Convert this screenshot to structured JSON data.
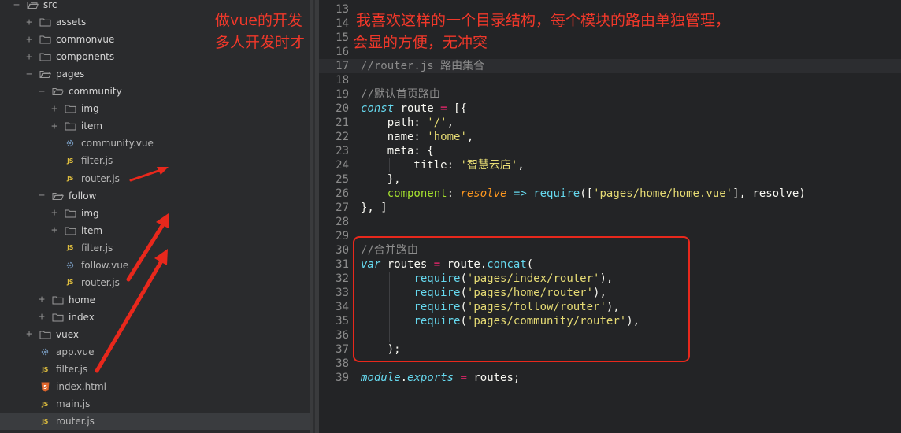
{
  "sidebar": {
    "items": [
      {
        "name": "src",
        "type": "folder",
        "open": true,
        "depth": 0
      },
      {
        "name": "assets",
        "type": "folder",
        "open": false,
        "depth": 1
      },
      {
        "name": "commonvue",
        "type": "folder",
        "open": false,
        "depth": 1
      },
      {
        "name": "components",
        "type": "folder",
        "open": false,
        "depth": 1
      },
      {
        "name": "pages",
        "type": "folder",
        "open": true,
        "depth": 1
      },
      {
        "name": "community",
        "type": "folder",
        "open": true,
        "depth": 2
      },
      {
        "name": "img",
        "type": "folder",
        "open": false,
        "depth": 3
      },
      {
        "name": "item",
        "type": "folder",
        "open": false,
        "depth": 3
      },
      {
        "name": "community.vue",
        "type": "vue",
        "depth": 3
      },
      {
        "name": "filter.js",
        "type": "js",
        "depth": 3
      },
      {
        "name": "router.js",
        "type": "js",
        "depth": 3
      },
      {
        "name": "follow",
        "type": "folder",
        "open": true,
        "depth": 2
      },
      {
        "name": "img",
        "type": "folder",
        "open": false,
        "depth": 3
      },
      {
        "name": "item",
        "type": "folder",
        "open": false,
        "depth": 3
      },
      {
        "name": "filter.js",
        "type": "js",
        "depth": 3
      },
      {
        "name": "follow.vue",
        "type": "vue",
        "depth": 3
      },
      {
        "name": "router.js",
        "type": "js",
        "depth": 3
      },
      {
        "name": "home",
        "type": "folder",
        "open": false,
        "depth": 2
      },
      {
        "name": "index",
        "type": "folder",
        "open": false,
        "depth": 2
      },
      {
        "name": "vuex",
        "type": "folder",
        "open": false,
        "depth": 1
      },
      {
        "name": "app.vue",
        "type": "vue",
        "depth": 1
      },
      {
        "name": "filter.js",
        "type": "js",
        "depth": 1
      },
      {
        "name": "index.html",
        "type": "html",
        "depth": 1
      },
      {
        "name": "main.js",
        "type": "js",
        "depth": 1
      },
      {
        "name": "router.js",
        "type": "js",
        "depth": 1,
        "selected": true
      }
    ]
  },
  "editor": {
    "lines": [
      {
        "n": "13",
        "tokens": []
      },
      {
        "n": "14",
        "tokens": []
      },
      {
        "n": "15",
        "tokens": []
      },
      {
        "n": "16",
        "tokens": []
      },
      {
        "n": "17",
        "active": true,
        "tokens": [
          {
            "t": "comment",
            "v": "//router.js 路由集合"
          }
        ]
      },
      {
        "n": "18",
        "tokens": []
      },
      {
        "n": "19",
        "tokens": [
          {
            "t": "comment",
            "v": "//默认首页路由"
          }
        ]
      },
      {
        "n": "20",
        "tokens": [
          {
            "t": "keyword",
            "v": "const"
          },
          {
            "t": "default",
            "v": " route "
          },
          {
            "t": "op",
            "v": "="
          },
          {
            "t": "default",
            "v": " [{"
          }
        ]
      },
      {
        "n": "21",
        "tokens": [
          {
            "t": "default",
            "v": "    path: "
          },
          {
            "t": "string",
            "v": "'/'"
          },
          {
            "t": "default",
            "v": ","
          }
        ]
      },
      {
        "n": "22",
        "tokens": [
          {
            "t": "default",
            "v": "    name: "
          },
          {
            "t": "string",
            "v": "'home'"
          },
          {
            "t": "default",
            "v": ","
          }
        ]
      },
      {
        "n": "23",
        "tokens": [
          {
            "t": "default",
            "v": "    meta: {"
          }
        ]
      },
      {
        "n": "24",
        "tokens": [
          {
            "t": "default",
            "v": "        title: "
          },
          {
            "t": "string",
            "v": "'智慧云店'"
          },
          {
            "t": "default",
            "v": ","
          }
        ]
      },
      {
        "n": "25",
        "tokens": [
          {
            "t": "default",
            "v": "    },"
          }
        ]
      },
      {
        "n": "26",
        "tokens": [
          {
            "t": "default",
            "v": "    "
          },
          {
            "t": "prop",
            "v": "component"
          },
          {
            "t": "default",
            "v": ": "
          },
          {
            "t": "param",
            "v": "resolve"
          },
          {
            "t": "default",
            "v": " "
          },
          {
            "t": "func",
            "v": "=>"
          },
          {
            "t": "default",
            "v": " "
          },
          {
            "t": "func",
            "v": "require"
          },
          {
            "t": "default",
            "v": "(["
          },
          {
            "t": "string",
            "v": "'pages/home/home.vue'"
          },
          {
            "t": "default",
            "v": "], resolve)"
          }
        ]
      },
      {
        "n": "27",
        "tokens": [
          {
            "t": "default",
            "v": "}, ]"
          }
        ]
      },
      {
        "n": "28",
        "tokens": []
      },
      {
        "n": "29",
        "tokens": []
      },
      {
        "n": "30",
        "tokens": [
          {
            "t": "comment",
            "v": "//合并路由"
          }
        ]
      },
      {
        "n": "31",
        "tokens": [
          {
            "t": "keyword",
            "v": "var"
          },
          {
            "t": "default",
            "v": " routes "
          },
          {
            "t": "op",
            "v": "="
          },
          {
            "t": "default",
            "v": " route."
          },
          {
            "t": "func",
            "v": "concat"
          },
          {
            "t": "default",
            "v": "("
          }
        ]
      },
      {
        "n": "32",
        "tokens": [
          {
            "t": "default",
            "v": "        "
          },
          {
            "t": "func",
            "v": "require"
          },
          {
            "t": "default",
            "v": "("
          },
          {
            "t": "string",
            "v": "'pages/index/router'"
          },
          {
            "t": "default",
            "v": "),"
          }
        ]
      },
      {
        "n": "33",
        "tokens": [
          {
            "t": "default",
            "v": "        "
          },
          {
            "t": "func",
            "v": "require"
          },
          {
            "t": "default",
            "v": "("
          },
          {
            "t": "string",
            "v": "'pages/home/router'"
          },
          {
            "t": "default",
            "v": "),"
          }
        ]
      },
      {
        "n": "34",
        "tokens": [
          {
            "t": "default",
            "v": "        "
          },
          {
            "t": "func",
            "v": "require"
          },
          {
            "t": "default",
            "v": "("
          },
          {
            "t": "string",
            "v": "'pages/follow/router'"
          },
          {
            "t": "default",
            "v": "),"
          }
        ]
      },
      {
        "n": "35",
        "tokens": [
          {
            "t": "default",
            "v": "        "
          },
          {
            "t": "func",
            "v": "require"
          },
          {
            "t": "default",
            "v": "("
          },
          {
            "t": "string",
            "v": "'pages/community/router'"
          },
          {
            "t": "default",
            "v": "),"
          }
        ]
      },
      {
        "n": "36",
        "tokens": []
      },
      {
        "n": "37",
        "tokens": [
          {
            "t": "default",
            "v": "    );"
          }
        ]
      },
      {
        "n": "38",
        "tokens": []
      },
      {
        "n": "39",
        "tokens": [
          {
            "t": "keyword",
            "v": "module"
          },
          {
            "t": "default",
            "v": "."
          },
          {
            "t": "keyword",
            "v": "exports"
          },
          {
            "t": "default",
            "v": " "
          },
          {
            "t": "op",
            "v": "="
          },
          {
            "t": "default",
            "v": " routes;"
          }
        ]
      }
    ]
  },
  "annotations": {
    "line1_left": "做vue的开发",
    "line1_right": "我喜欢这样的一个目录结构，每个模块的路由单独管理，",
    "line2_left": "多人开发时才",
    "line2_right": "会显的方便，无冲突"
  },
  "colors": {
    "annotation": "#e8281c",
    "folder_icon": "#9a9a9a",
    "js_icon": "#e0bf3e",
    "vue_icon": "#6f8fb0",
    "html_icon": "#e0662c"
  }
}
